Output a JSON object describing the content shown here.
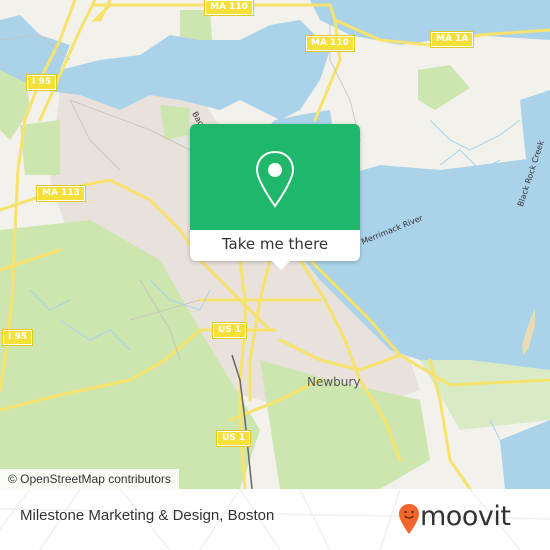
{
  "map": {
    "attribution": "© OpenStreetMap contributors",
    "road_shields": [
      {
        "label": "MA 110",
        "id": "ma110-top"
      },
      {
        "label": "MA 110",
        "id": "ma110-mid"
      },
      {
        "label": "MA 1A",
        "id": "ma1a"
      },
      {
        "label": "I 95",
        "id": "i95-north"
      },
      {
        "label": "MA 113",
        "id": "ma113"
      },
      {
        "label": "I 95",
        "id": "i95-south"
      },
      {
        "label": "US 1",
        "id": "us1-north"
      },
      {
        "label": "US 1",
        "id": "us1-south"
      }
    ],
    "place_labels": {
      "town": "Newbury",
      "river": "Merrimack River",
      "creek": "Black Rock Creek",
      "bay_road": "Bac"
    },
    "colors": {
      "land": "#f2f1ec",
      "water": "#aad3ea",
      "park": "#cde6b0",
      "urban": "#e8e1dc",
      "road": "#f7e26b"
    }
  },
  "popup": {
    "icon": "map-pin-icon",
    "cta_label": "Take me there",
    "color": "#1fb86b"
  },
  "footer": {
    "place_name": "Milestone Marketing & Design, Boston",
    "brand": "moovit",
    "brand_icon": "moovit-smiley-pin-icon",
    "brand_color": "#f2662b"
  }
}
